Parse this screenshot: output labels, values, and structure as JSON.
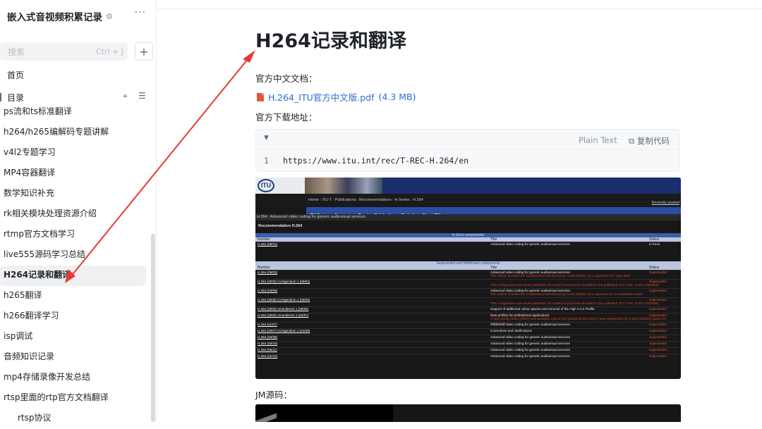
{
  "sidebar": {
    "kb_title": "嵌入式音视频积累记录",
    "search": {
      "placeholder": "搜索",
      "shortcut": "Ctrl + J"
    },
    "home": "首页",
    "toc": "目录",
    "items": [
      {
        "label": "ps流和ts标准翻译"
      },
      {
        "label": "h264/h265编解码专题讲解"
      },
      {
        "label": "v4l2专题学习"
      },
      {
        "label": "MP4容器翻译"
      },
      {
        "label": "数学知识补充"
      },
      {
        "label": "rk相关模块处理资源介绍"
      },
      {
        "label": "rtmp官方文档学习"
      },
      {
        "label": "live555源码学习总结"
      },
      {
        "label": "H264记录和翻译",
        "active": true
      },
      {
        "label": "h265翻译"
      },
      {
        "label": "h266翻译学习"
      },
      {
        "label": "isp调试"
      },
      {
        "label": "音频知识记录"
      },
      {
        "label": "mp4存储录像开发总结"
      },
      {
        "label": "rtsp里面的rtp官方文档翻译"
      },
      {
        "label": "rtsp协议",
        "sub": true
      }
    ]
  },
  "doc": {
    "title": "H264记录和翻译",
    "p1": "官方中文文档：",
    "attachment": {
      "name": "H.264_ITU官方中文版.pdf",
      "size": "(4.3 MB)"
    },
    "p2": "官方下载地址：",
    "code": {
      "lang": "Plain Text",
      "copy": "复制代码",
      "line_no": "1",
      "text": "https://www.itu.int/rec/T-REC-H.264/en"
    },
    "jm_label": "JM源码："
  },
  "itu": {
    "logo": "ITU",
    "breadcrumb": "Home : ITU-T : Publications : Recommendations : H Series : H.264",
    "recent": "Recently posted",
    "nav": [
      "ITU Sectors",
      "Newsroom",
      "Events",
      "Publications",
      "Statistics",
      "About ITU"
    ],
    "subheading": "H.264 : Advanced video coding for generic audiovisual services",
    "rec_heading": "Recommendation H.264",
    "in_force": "In force components",
    "superseded": "Superseded and Withdrawn components",
    "cols": [
      "Number",
      "Title",
      "Status"
    ],
    "in_force_rows": [
      {
        "num": "H.264 (08/21)",
        "title": "Advanced video coding for generic audiovisual services",
        "status": "In force"
      }
    ],
    "rows": [
      {
        "num": "H.264 (05/03)",
        "title": "Advanced video coding for generic audiovisual services",
        "status": "Superseded",
        "note": "This edition includes the modifications introduced by H.264 (2003) Cor.1 approved on 7 May 2004"
      },
      {
        "num": "H.264 (2003) Corrigendum 1 (05/04)",
        "title": "",
        "status": "Superseded",
        "note": "This corrigendum was never published, its content having been included in the published ITU-T Rec. H.264 (05/2003)"
      },
      {
        "num": "H.264 (03/05)",
        "title": "Advanced video coding for generic audiovisual services",
        "status": "Superseded",
        "note": "This edition includes the modifications introduced by H.264 (2005) Cor.1 approved on 13 September 2005"
      },
      {
        "num": "H.264 (2005) Corrigendum 1 (09/05)",
        "title": "",
        "status": "Superseded",
        "note": "This corrigendum was never published, its content having been included in the published ITU-T Rec. H.264 (03/2005)"
      },
      {
        "num": "H.264 (2005) Amendment 1 (06/06)",
        "title": "Support of additional colour spaces and removal of the High 4:4:4 Profile",
        "status": "Superseded",
        "note": ""
      },
      {
        "num": "H.264 (2005) Amendment 2 (04/07)",
        "title": "New profiles for professional applications",
        "status": "Superseded",
        "note": "H.264 (2005) Amd.2 (2007) was available only as pre-published text since it was superseded by H.264 (11/2007) before its publication"
      },
      {
        "num": "H.264 (11/07)",
        "title": "Advanced video coding for generic audiovisual services",
        "status": "Superseded",
        "note": ""
      },
      {
        "num": "H.264 (2007) Corrigendum 1 (01/09)",
        "title": "Corrections and clarifications",
        "status": "Superseded",
        "note": ""
      },
      {
        "num": "H.264 (03/09)",
        "title": "Advanced video coding for generic audiovisual services",
        "status": "Superseded",
        "note": ""
      },
      {
        "num": "H.264 (03/10)",
        "title": "Advanced video coding for generic audiovisual services",
        "status": "Superseded",
        "note": ""
      },
      {
        "num": "H.264 (06/11)",
        "title": "Advanced video coding for generic audiovisual services",
        "status": "Superseded",
        "note": ""
      },
      {
        "num": "H.264 (01/12)",
        "title": "Advanced video coding for generic audiovisual services",
        "status": "Superseded",
        "note": ""
      }
    ]
  },
  "colors": {
    "link": "#2f6ad1",
    "annotation_arrow": "#e53935",
    "pdf_icon": "#e2573b"
  }
}
